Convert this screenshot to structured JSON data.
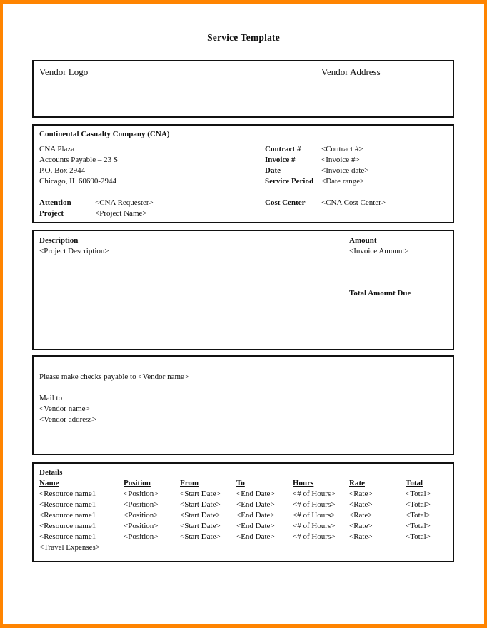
{
  "colors": {
    "frame": "#ff8400",
    "border": "#111111",
    "page": "#ffffff"
  },
  "title": "Service Template",
  "vendor_header": {
    "logo_label": "Vendor Logo",
    "address_label": "Vendor Address"
  },
  "customer": {
    "company": "Continental Casualty Company (CNA)",
    "address_lines": [
      "CNA Plaza",
      "Accounts Payable – 23 S",
      "P.O. Box 2944",
      "Chicago, IL 60690-2944"
    ],
    "attention_label": "Attention",
    "attention_value": "<CNA Requester>",
    "project_label": "Project",
    "project_value": "<Project Name>",
    "fields": [
      {
        "label": "Contract #",
        "value": "<Contract #>"
      },
      {
        "label": "Invoice #",
        "value": "<Invoice #>"
      },
      {
        "label": "Date",
        "value": "<Invoice date>"
      },
      {
        "label": "Service Period",
        "value": "<Date range>"
      }
    ],
    "cost_center_label": "Cost Center",
    "cost_center_value": "<CNA Cost Center>"
  },
  "description": {
    "label": "Description",
    "value": "<Project Description>",
    "amount_label": "Amount",
    "amount_value": "<Invoice Amount>",
    "total_label": "Total Amount Due"
  },
  "payment": {
    "payable_line": "Please make checks payable to <Vendor name>",
    "mail_to": "Mail to",
    "vendor_name": "<Vendor name>",
    "vendor_address": "<Vendor address>"
  },
  "details": {
    "heading": "Details",
    "columns": [
      "Name",
      "Position",
      "From",
      "To",
      "Hours",
      "Rate",
      "Total"
    ],
    "rows": [
      [
        "<Resource name1",
        "<Position>",
        "<Start Date>",
        "<End Date>",
        "<# of Hours>",
        "<Rate>",
        "<Total>"
      ],
      [
        "<Resource name1",
        "<Position>",
        "<Start Date>",
        "<End Date>",
        "<# of Hours>",
        "<Rate>",
        "<Total>"
      ],
      [
        "<Resource name1",
        "<Position>",
        "<Start Date>",
        "<End Date>",
        "<# of Hours>",
        "<Rate>",
        "<Total>"
      ],
      [
        "<Resource name1",
        "<Position>",
        "<Start Date>",
        "<End Date>",
        "<# of Hours>",
        "<Rate>",
        "<Total>"
      ],
      [
        "<Resource name1",
        "<Position>",
        "<Start Date>",
        "<End Date>",
        "<# of Hours>",
        "<Rate>",
        "<Total>"
      ]
    ],
    "travel": "<Travel Expenses>"
  }
}
